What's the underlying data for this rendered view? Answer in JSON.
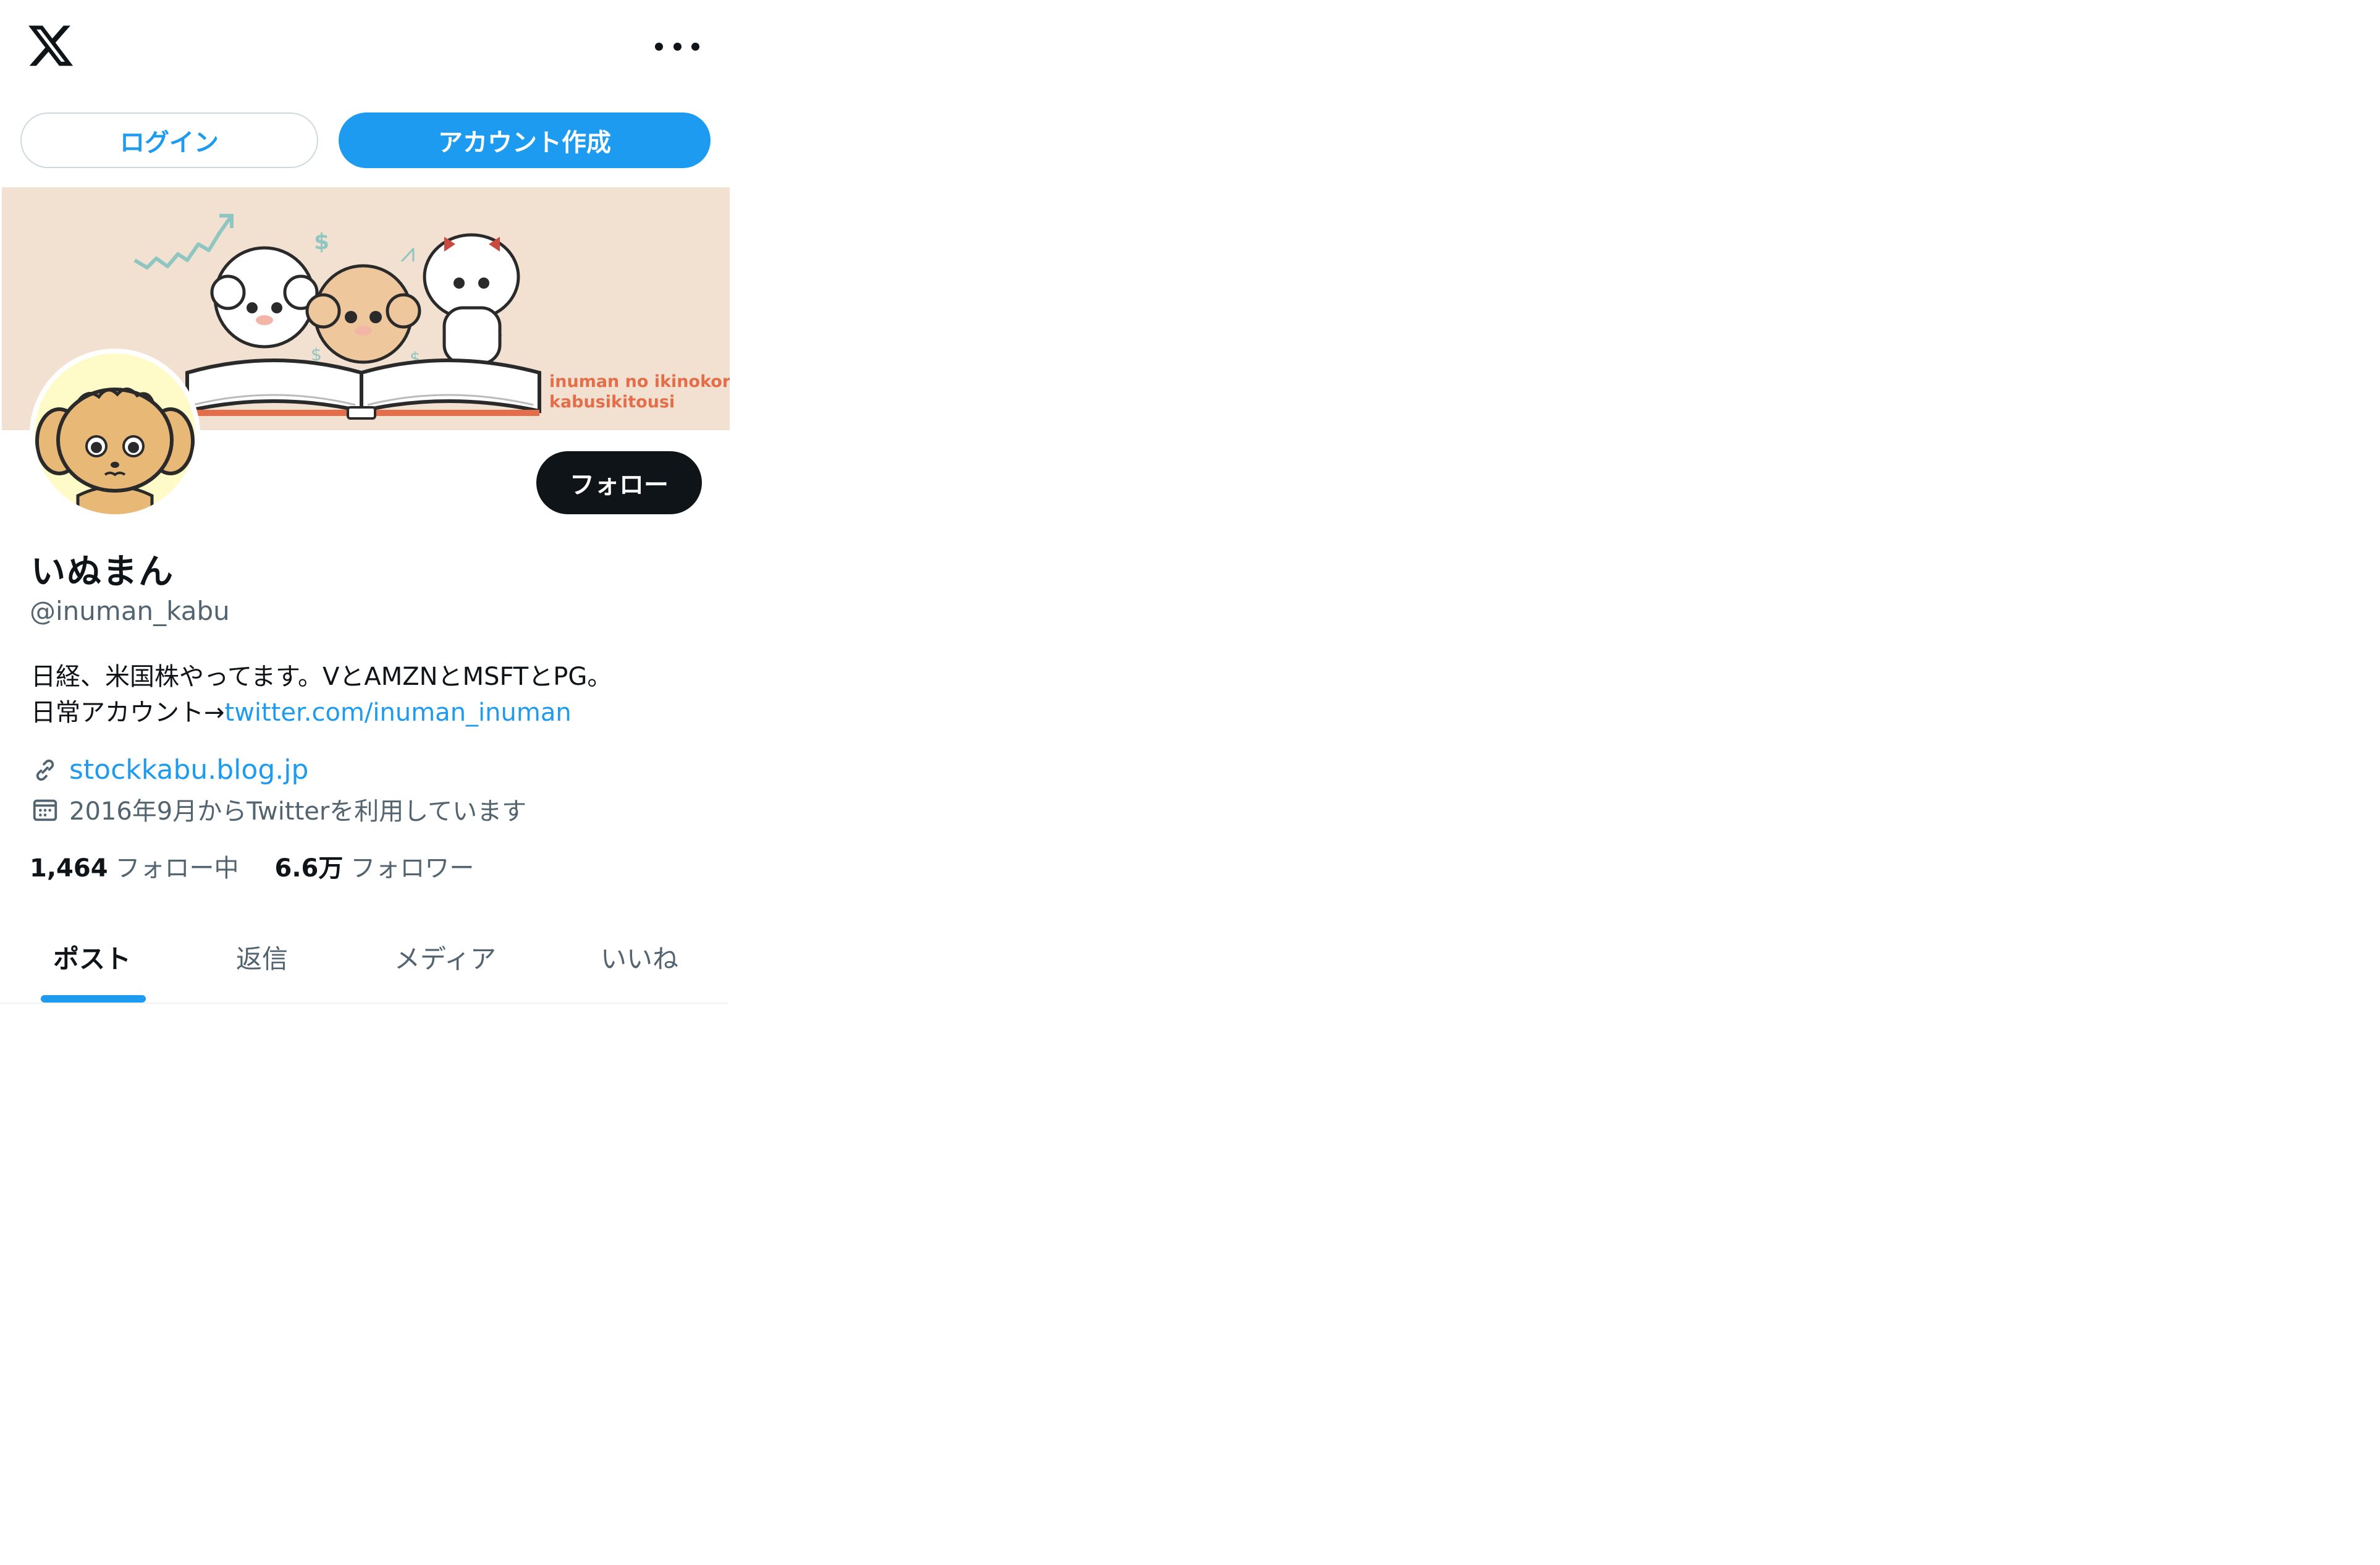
{
  "header": {
    "logo": "x-logo-icon",
    "more": "more-horizontal-icon"
  },
  "auth": {
    "login_label": "ログイン",
    "signup_label": "アカウント作成"
  },
  "banner": {
    "caption_line1": "inuman no ikinokori",
    "caption_line2": "kabusikitousi",
    "bg_color": "#f2e0d0"
  },
  "profile": {
    "follow_label": "フォロー",
    "display_name": "いぬまん",
    "handle": "@inuman_kabu",
    "bio_line1": "日経、米国株やってます。VとAMZNとMSFTとPG。",
    "bio_line2_prefix": "日常アカウント→",
    "bio_line2_link": "twitter.com/inuman_inuman",
    "website": "stockkabu.blog.jp",
    "joined": "2016年9月からTwitterを利用しています"
  },
  "stats": {
    "following_count": "1,464",
    "following_label": "フォロー中",
    "followers_count": "6.6万",
    "followers_label": "フォロワー"
  },
  "tabs": [
    {
      "label": "ポスト",
      "active": true
    },
    {
      "label": "返信",
      "active": false
    },
    {
      "label": "メディア",
      "active": false
    },
    {
      "label": "いいね",
      "active": false
    }
  ],
  "colors": {
    "accent": "#1d9bf0",
    "text": "#0f1419",
    "muted": "#536471",
    "avatar_bg": "#fffbc8"
  }
}
